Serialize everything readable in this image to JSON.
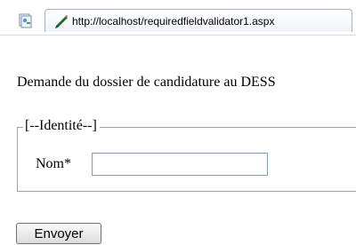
{
  "browser": {
    "tab": {
      "url": "http://localhost/requiredfieldvalidator1.aspx",
      "page_icon": "page-icon",
      "favicon": "ie-favicon-icon"
    }
  },
  "page": {
    "heading": "Demande du dossier de candidature au DESS",
    "fieldset": {
      "legend": "[--Identité--]"
    },
    "form": {
      "nom_label": "Nom*",
      "nom_value": "",
      "submit_label": "Envoyer"
    }
  },
  "colors": {
    "tab_border": "#9fb3cc",
    "input_border": "#7f9db9",
    "fieldset_border": "#a0a0a0"
  }
}
